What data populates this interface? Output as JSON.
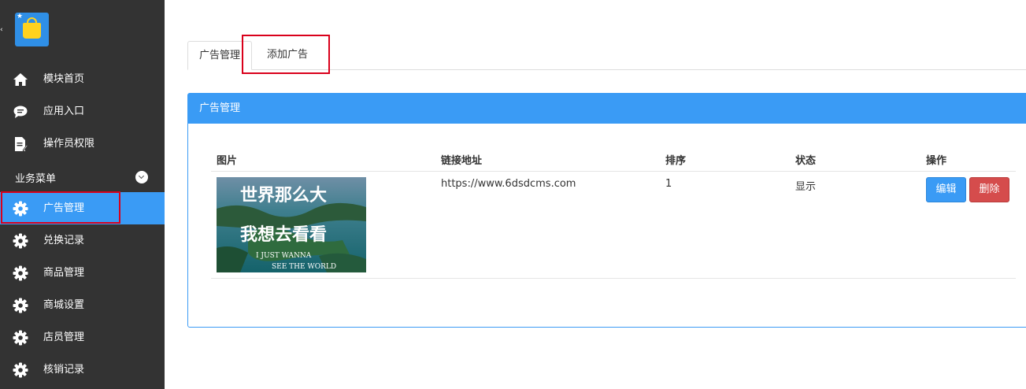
{
  "sidebar": {
    "items_top": [
      {
        "label": "模块首页",
        "icon": "home-icon"
      },
      {
        "label": "应用入口",
        "icon": "chat-bubble-icon"
      },
      {
        "label": "操作员权限",
        "icon": "document-edit-icon"
      }
    ],
    "section_label": "业务菜单",
    "items_business": [
      {
        "label": "广告管理",
        "icon": "gear-icon",
        "active": true
      },
      {
        "label": "兑换记录",
        "icon": "gear-icon"
      },
      {
        "label": "商品管理",
        "icon": "gear-icon"
      },
      {
        "label": "商城设置",
        "icon": "gear-icon"
      },
      {
        "label": "店员管理",
        "icon": "gear-icon"
      },
      {
        "label": "核销记录",
        "icon": "gear-icon"
      }
    ]
  },
  "tabs": [
    {
      "label": "广告管理",
      "active": true
    },
    {
      "label": "添加广告",
      "active": false
    }
  ],
  "panel": {
    "title": "广告管理",
    "columns": [
      "图片",
      "链接地址",
      "排序",
      "状态",
      "操作"
    ],
    "rows": [
      {
        "image_lines": [
          "世界那么大",
          "我想去看看",
          "I JUST WANNA",
          "SEE THE WORLD"
        ],
        "link": "https://www.6dsdcms.com",
        "order": "1",
        "status": "显示",
        "edit_label": "编辑",
        "delete_label": "删除"
      }
    ]
  },
  "colors": {
    "sidebar_bg": "#333333",
    "accent": "#3a9bf5",
    "danger": "#d54c4c",
    "highlight_box": "#d9001b"
  }
}
